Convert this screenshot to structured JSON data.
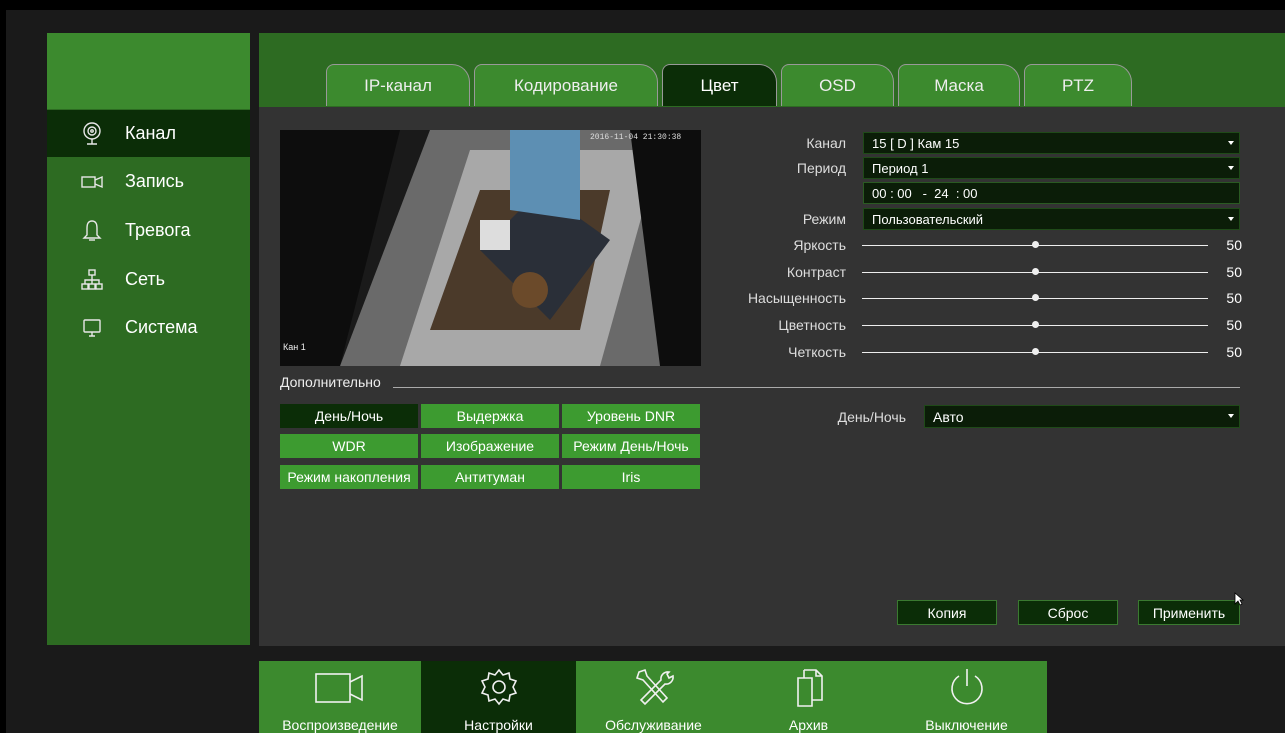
{
  "sidebar": {
    "items": [
      {
        "label": "Канал",
        "icon": "camera-lens-icon",
        "active": true
      },
      {
        "label": "Запись",
        "icon": "video-camera-icon",
        "active": false
      },
      {
        "label": "Тревога",
        "icon": "bell-icon",
        "active": false
      },
      {
        "label": "Сеть",
        "icon": "network-icon",
        "active": false
      },
      {
        "label": "Система",
        "icon": "monitor-icon",
        "active": false
      }
    ]
  },
  "tabs": [
    {
      "label": "IP-канал"
    },
    {
      "label": "Кодирование"
    },
    {
      "label": "Цвет",
      "active": true
    },
    {
      "label": "OSD"
    },
    {
      "label": "Маска"
    },
    {
      "label": "PTZ"
    }
  ],
  "preview": {
    "timestamp": "2016-11-04 21:30:38",
    "camera_name": "Кан 1"
  },
  "settings": {
    "channel": {
      "label": "Канал",
      "value": "15 [ D ] Кам 15"
    },
    "period": {
      "label": "Период",
      "value": "Период 1"
    },
    "time_range": "00 : 00   -  24  : 00",
    "mode": {
      "label": "Режим",
      "value": "Пользовательский"
    },
    "sliders": [
      {
        "label": "Яркость",
        "value": 50
      },
      {
        "label": "Контраст",
        "value": 50
      },
      {
        "label": "Насыщенность",
        "value": 50
      },
      {
        "label": "Цветность",
        "value": 50
      },
      {
        "label": "Четкость",
        "value": 50
      }
    ]
  },
  "advanced": {
    "title": "Дополнительно",
    "buttons": [
      {
        "label": "День/Ночь",
        "active": true
      },
      {
        "label": "Выдержка"
      },
      {
        "label": "Уровень DNR"
      },
      {
        "label": "WDR"
      },
      {
        "label": "Изображение"
      },
      {
        "label": "Режим День/Ночь"
      },
      {
        "label": "Режим накопления"
      },
      {
        "label": "Антитуман"
      },
      {
        "label": "Iris"
      }
    ],
    "daynight": {
      "label": "День/Ночь",
      "value": "Авто"
    }
  },
  "actions": {
    "copy": "Копия",
    "reset": "Сброс",
    "apply": "Применить"
  },
  "bottom_bar": [
    {
      "label": "Воспроизведение",
      "icon": "video-camera-icon"
    },
    {
      "label": "Настройки",
      "icon": "gear-icon",
      "active": true
    },
    {
      "label": "Обслуживание",
      "icon": "tools-icon"
    },
    {
      "label": "Архив",
      "icon": "files-icon"
    },
    {
      "label": "Выключение",
      "icon": "power-icon"
    }
  ],
  "colors": {
    "panel_green": "#3c8a2e",
    "dark_green": "#0b2d07",
    "button_green": "#3d9b30",
    "panel_gray": "#333333"
  }
}
